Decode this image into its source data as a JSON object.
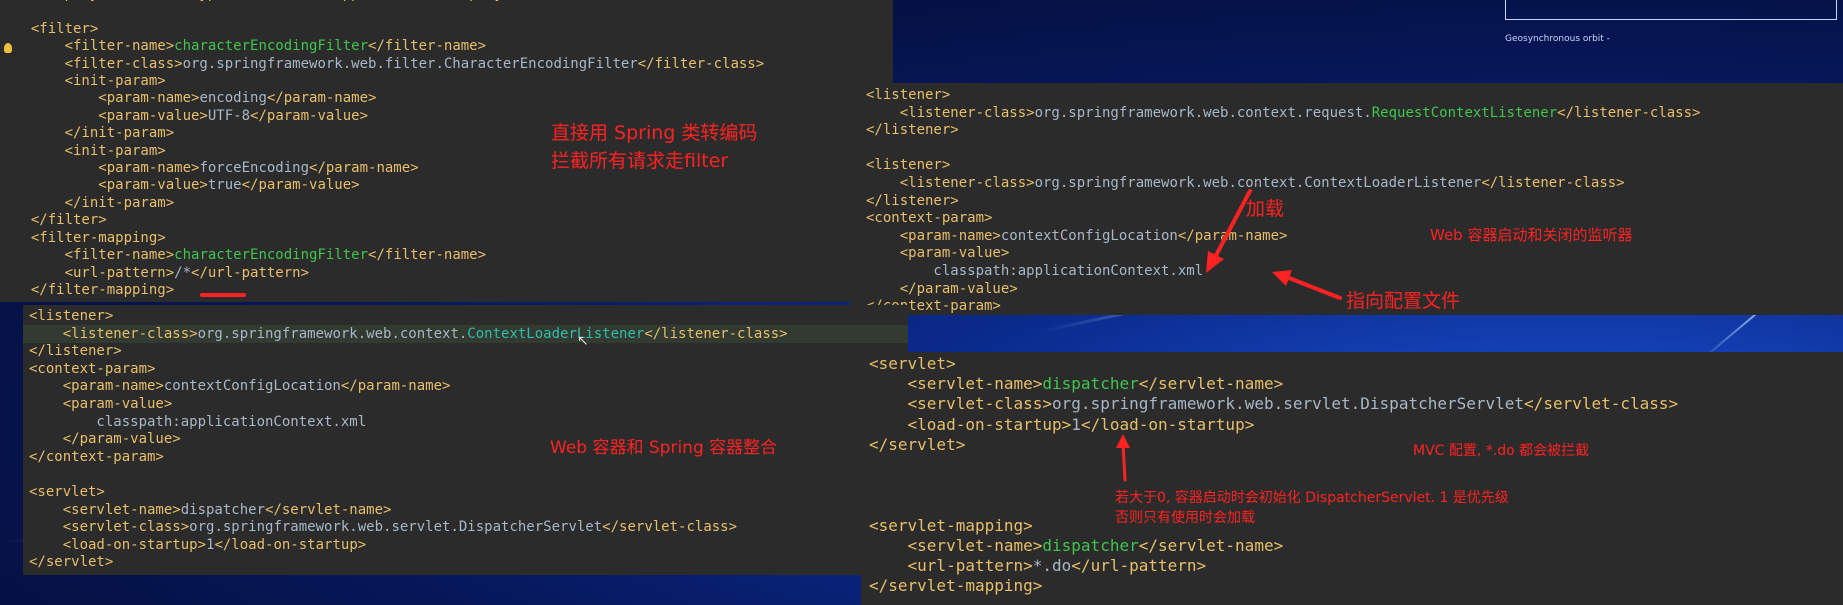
{
  "top_right_caption": "Geosynchronous orbit -",
  "panel_filter": {
    "lines": [
      [
        [
          "t",
          "  <display-name>Archetype Created Web Application</display-name>"
        ]
      ],
      [],
      [
        [
          "t",
          "  <filter>"
        ]
      ],
      [
        [
          "t",
          "      <filter-name>"
        ],
        [
          "hl",
          "characterEncodingFilter"
        ],
        [
          "t",
          "</filter-name>"
        ]
      ],
      [
        [
          "t",
          "      <filter-class>"
        ],
        [
          "v",
          "org.springframework.web.filter.CharacterEncodingFilter"
        ],
        [
          "t",
          "</filter-class>"
        ]
      ],
      [
        [
          "t",
          "      <init-param>"
        ]
      ],
      [
        [
          "t",
          "          <param-name>"
        ],
        [
          "v",
          "encoding"
        ],
        [
          "t",
          "</param-name>"
        ]
      ],
      [
        [
          "t",
          "          <param-value>"
        ],
        [
          "v",
          "UTF-8"
        ],
        [
          "t",
          "</param-value>"
        ]
      ],
      [
        [
          "t",
          "      </init-param>"
        ]
      ],
      [
        [
          "t",
          "      <init-param>"
        ]
      ],
      [
        [
          "t",
          "          <param-name>"
        ],
        [
          "v",
          "forceEncoding"
        ],
        [
          "t",
          "</param-name>"
        ]
      ],
      [
        [
          "t",
          "          <param-value>"
        ],
        [
          "v",
          "true"
        ],
        [
          "t",
          "</param-value>"
        ]
      ],
      [
        [
          "t",
          "      </init-param>"
        ]
      ],
      [
        [
          "t",
          "  </filter>"
        ]
      ],
      [
        [
          "t",
          "  <filter-mapping>"
        ]
      ],
      [
        [
          "t",
          "      <filter-name>"
        ],
        [
          "hl",
          "characterEncodingFilter"
        ],
        [
          "t",
          "</filter-name>"
        ]
      ],
      [
        [
          "t",
          "      <url-pattern>"
        ],
        [
          "v",
          "/*"
        ],
        [
          "t",
          "</url-pattern>"
        ]
      ],
      [
        [
          "t",
          "  </filter-mapping>"
        ]
      ]
    ]
  },
  "panel_listener_top": {
    "lines": [
      [
        [
          "t",
          "<listener>"
        ]
      ],
      [
        [
          "t",
          "    <listener-class>"
        ],
        [
          "v",
          "org.springframework.web.context.request."
        ],
        [
          "hl",
          "RequestContextListener"
        ],
        [
          "t",
          "</listener-class>"
        ]
      ],
      [
        [
          "t",
          "</listener>"
        ]
      ],
      [],
      [
        [
          "t",
          "<listener>"
        ]
      ],
      [
        [
          "t",
          "    <listener-class>"
        ],
        [
          "v",
          "org.springframework.web.context.ContextLoaderListener"
        ],
        [
          "t",
          "</listener-class>"
        ]
      ],
      [
        [
          "t",
          "</listener>"
        ]
      ],
      [
        [
          "t",
          "<context-param>"
        ]
      ],
      [
        [
          "t",
          "    <param-name>"
        ],
        [
          "v",
          "contextConfigLocation"
        ],
        [
          "t",
          "</param-name>"
        ]
      ],
      [
        [
          "t",
          "    <param-value>"
        ]
      ],
      [
        [
          "v",
          "        classpath:applicationContext.xml"
        ]
      ],
      [
        [
          "t",
          "    </param-value>"
        ]
      ],
      [
        [
          "t",
          "</context-param>"
        ]
      ]
    ]
  },
  "panel_bottom_left": {
    "lines": [
      [
        [
          "t",
          "<listener>"
        ]
      ],
      [
        [
          "t",
          "    <listener-class>"
        ],
        [
          "v",
          "org.springframework.web.context."
        ],
        [
          "hl2",
          "ContextLoaderListener"
        ],
        [
          "t",
          "</listener-class>"
        ]
      ],
      [
        [
          "t",
          "</listener>"
        ]
      ],
      [
        [
          "t",
          "<context-param>"
        ]
      ],
      [
        [
          "t",
          "    <param-name>"
        ],
        [
          "v",
          "contextConfigLocation"
        ],
        [
          "t",
          "</param-name>"
        ]
      ],
      [
        [
          "t",
          "    <param-value>"
        ]
      ],
      [
        [
          "v",
          "        classpath:applicationContext.xml"
        ]
      ],
      [
        [
          "t",
          "    </param-value>"
        ]
      ],
      [
        [
          "t",
          "</context-param>"
        ]
      ],
      [],
      [
        [
          "t",
          "<servlet>"
        ]
      ],
      [
        [
          "t",
          "    <servlet-name>"
        ],
        [
          "v",
          "dispatcher"
        ],
        [
          "t",
          "</servlet-name>"
        ]
      ],
      [
        [
          "t",
          "    <servlet-class>"
        ],
        [
          "v",
          "org.springframework.web.servlet.DispatcherServlet"
        ],
        [
          "t",
          "</servlet-class>"
        ]
      ],
      [
        [
          "t",
          "    <load-on-startup>"
        ],
        [
          "v",
          "1"
        ],
        [
          "t",
          "</load-on-startup>"
        ]
      ],
      [
        [
          "t",
          "</servlet>"
        ]
      ]
    ]
  },
  "panel_servlet": {
    "lines": [
      [
        [
          "t",
          "<servlet>"
        ]
      ],
      [
        [
          "t",
          "    <servlet-name>"
        ],
        [
          "hl",
          "dispatcher"
        ],
        [
          "t",
          "</servlet-name>"
        ]
      ],
      [
        [
          "t",
          "    <servlet-class>"
        ],
        [
          "v",
          "org.springframework.web.servlet.DispatcherServlet"
        ],
        [
          "t",
          "</servlet-class>"
        ]
      ],
      [
        [
          "t",
          "    <load-on-startup>"
        ],
        [
          "v",
          "1"
        ],
        [
          "t",
          "</load-on-startup>"
        ]
      ],
      [
        [
          "t",
          "</servlet>"
        ]
      ],
      [],
      [],
      [],
      [
        [
          "t",
          "<servlet-mapping>"
        ]
      ],
      [
        [
          "t",
          "    <servlet-name>"
        ],
        [
          "hl",
          "dispatcher"
        ],
        [
          "t",
          "</servlet-name>"
        ]
      ],
      [
        [
          "t",
          "    <url-pattern>"
        ],
        [
          "v",
          "*.do"
        ],
        [
          "t",
          "</url-pattern>"
        ]
      ],
      [
        [
          "t",
          "</servlet-mapping>"
        ]
      ]
    ]
  },
  "annotations": {
    "filter_note_1": "直接用 Spring 类转编码",
    "filter_note_2": "拦截所有请求走filter",
    "load_label": "加载",
    "listener_note": "Web 容器启动和关闭的监听器",
    "config_pointer": "指向配置文件",
    "integration_note": "Web 容器和 Spring 容器整合",
    "mvc_note": "MVC 配置, *.do 都会被拦截",
    "startup_note_1": "若大于0, 容器启动时会初始化 DispatcherServlet. 1 是优先级",
    "startup_note_2": "否则只有使用时会加载"
  },
  "colors": {
    "tag": "#e8bf6a",
    "text": "#a9b7c6",
    "highlight": "#3fc64d",
    "highlight_alt": "#2fbea8",
    "annotation": "#ff2222",
    "panel_bg": "#2b2b2b"
  }
}
